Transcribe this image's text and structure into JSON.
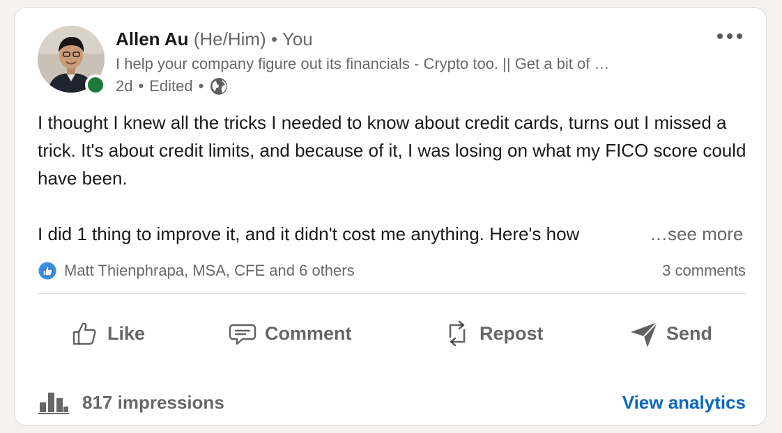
{
  "post": {
    "author": {
      "name": "Allen Au",
      "pronouns": "(He/Him)",
      "separator": "•",
      "relation": "You",
      "headline": "I help your company figure out its financials - Crypto too. || Get a bit of …",
      "age": "2d",
      "edited": "Edited",
      "visibility_icon": "globe-icon",
      "online": true
    },
    "more_icon": "more-horizontal-icon",
    "body": {
      "paragraph1": "I thought I knew all the tricks I needed to know about credit cards, turns out I missed a trick. It's about credit limits, and because of it, I was losing on what my FICO score could have been.",
      "paragraph2": "I did 1 thing to improve it, and it didn't cost me anything. Here's how",
      "see_more": "…see more"
    },
    "social": {
      "reaction_icon": "like-reaction-icon",
      "reactors": "Matt Thienphrapa, MSA, CFE and 6 others",
      "comments": "3 comments"
    },
    "actions": [
      {
        "label": "Like",
        "icon": "thumbs-up-icon"
      },
      {
        "label": "Comment",
        "icon": "comment-icon"
      },
      {
        "label": "Repost",
        "icon": "repost-icon"
      },
      {
        "label": "Send",
        "icon": "send-icon"
      }
    ],
    "footer": {
      "impressions": "817 impressions",
      "analytics_link": "View analytics"
    }
  },
  "colors": {
    "accent": "#0a66c2",
    "online": "#1d7a3a",
    "like_badge": "#378fe9"
  }
}
